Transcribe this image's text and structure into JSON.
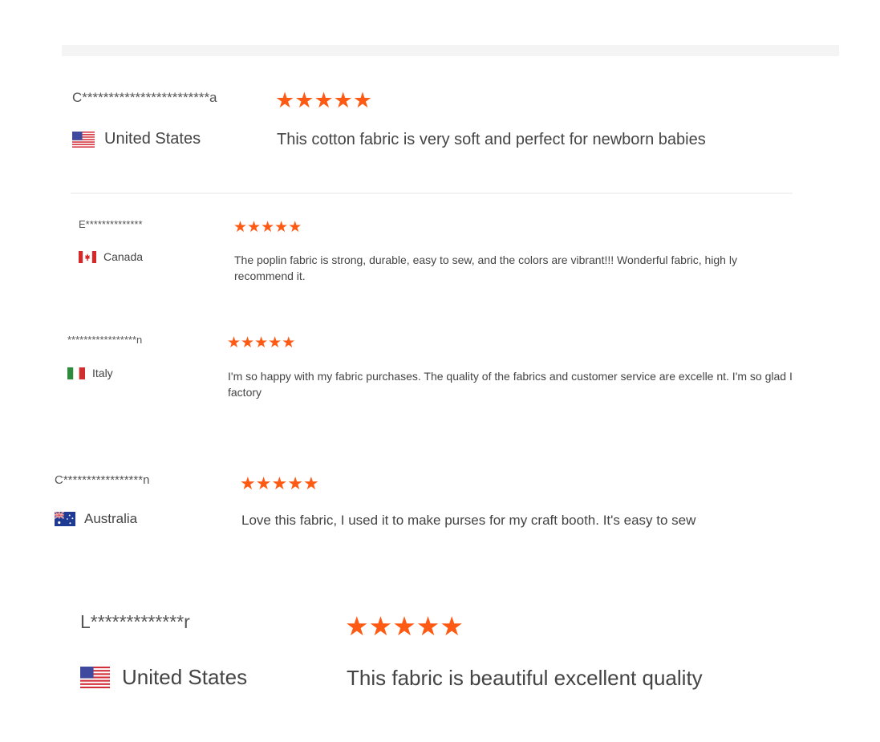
{
  "star_color": "#ff5a14",
  "reviews": [
    {
      "name": "C************************a",
      "rating": 5,
      "country": "United States",
      "flag": "us-flag",
      "text": "This cotton fabric is very soft and perfect for newborn babies"
    },
    {
      "name": "E**************",
      "rating": 5,
      "country": "Canada",
      "flag": "canada-flag",
      "text": "The poplin fabric is strong, durable, easy to sew, and the colors are vibrant!!! Wonderful fabric, high ly recommend it."
    },
    {
      "name": "*****************n",
      "rating": 5,
      "country": "Italy",
      "flag": "italy-flag",
      "text": "I'm so happy with my fabric purchases. The quality of the fabrics and customer service are excelle nt. I'm so glad I factory"
    },
    {
      "name": "C*****************n",
      "rating": 5,
      "country": "Australia",
      "flag": "australia-flag",
      "text": "Love this fabric, I used it to make purses for my craft booth. It's easy to sew"
    },
    {
      "name": "L*************r",
      "rating": 5,
      "country": "United States",
      "flag": "us-flag",
      "text": "This fabric is beautiful excellent quality"
    }
  ]
}
